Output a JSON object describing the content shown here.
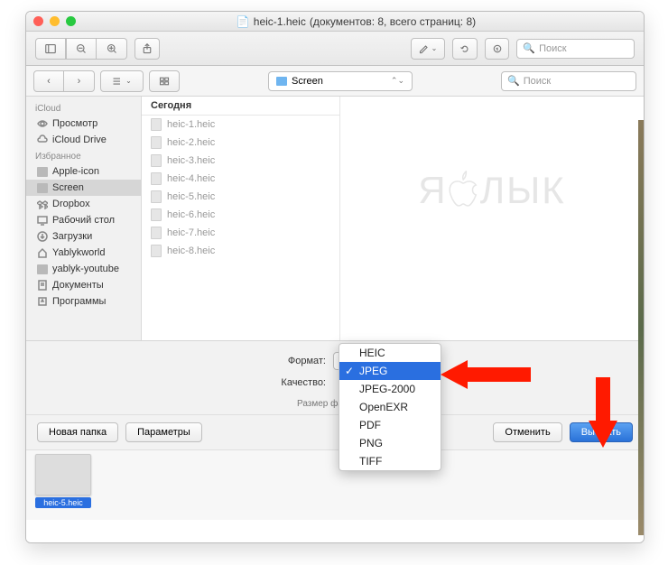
{
  "window": {
    "title_prefix": "heic-1.heic",
    "title_suffix": "(документов: 8, всего страниц: 8)"
  },
  "toolbar1": {
    "search_placeholder": "Поиск"
  },
  "toolbar2": {
    "path_folder": "Screen",
    "search_placeholder": "Поиск"
  },
  "sidebar": {
    "sections": [
      {
        "label": "iCloud",
        "items": [
          {
            "label": "Просмотр",
            "icon": "eye"
          },
          {
            "label": "iCloud Drive",
            "icon": "cloud"
          }
        ]
      },
      {
        "label": "Избранное",
        "items": [
          {
            "label": "Apple-icon",
            "icon": "folder"
          },
          {
            "label": "Screen",
            "icon": "folder",
            "selected": true
          },
          {
            "label": "Dropbox",
            "icon": "dropbox"
          },
          {
            "label": "Рабочий стол",
            "icon": "desktop"
          },
          {
            "label": "Загрузки",
            "icon": "download"
          },
          {
            "label": "Yablykworld",
            "icon": "home"
          },
          {
            "label": "yablyk-youtube",
            "icon": "folder"
          },
          {
            "label": "Документы",
            "icon": "doc"
          },
          {
            "label": "Программы",
            "icon": "app"
          }
        ]
      }
    ]
  },
  "files": {
    "header": "Сегодня",
    "items": [
      "heic-1.heic",
      "heic-2.heic",
      "heic-3.heic",
      "heic-4.heic",
      "heic-5.heic",
      "heic-6.heic",
      "heic-7.heic",
      "heic-8.heic"
    ]
  },
  "watermark": "ЯБЛЫК",
  "options": {
    "format_label": "Формат:",
    "quality_label": "Качество:",
    "filesize_label": "Размер файла:",
    "dropdown": {
      "items": [
        "HEIC",
        "JPEG",
        "JPEG-2000",
        "OpenEXR",
        "PDF",
        "PNG",
        "TIFF"
      ],
      "selected": "JPEG"
    }
  },
  "buttons": {
    "new_folder": "Новая папка",
    "params": "Параметры",
    "cancel": "Отменить",
    "choose": "Выбрать"
  },
  "thumb": {
    "label": "heic-5.heic"
  },
  "arrow_color": "#ff1a00"
}
